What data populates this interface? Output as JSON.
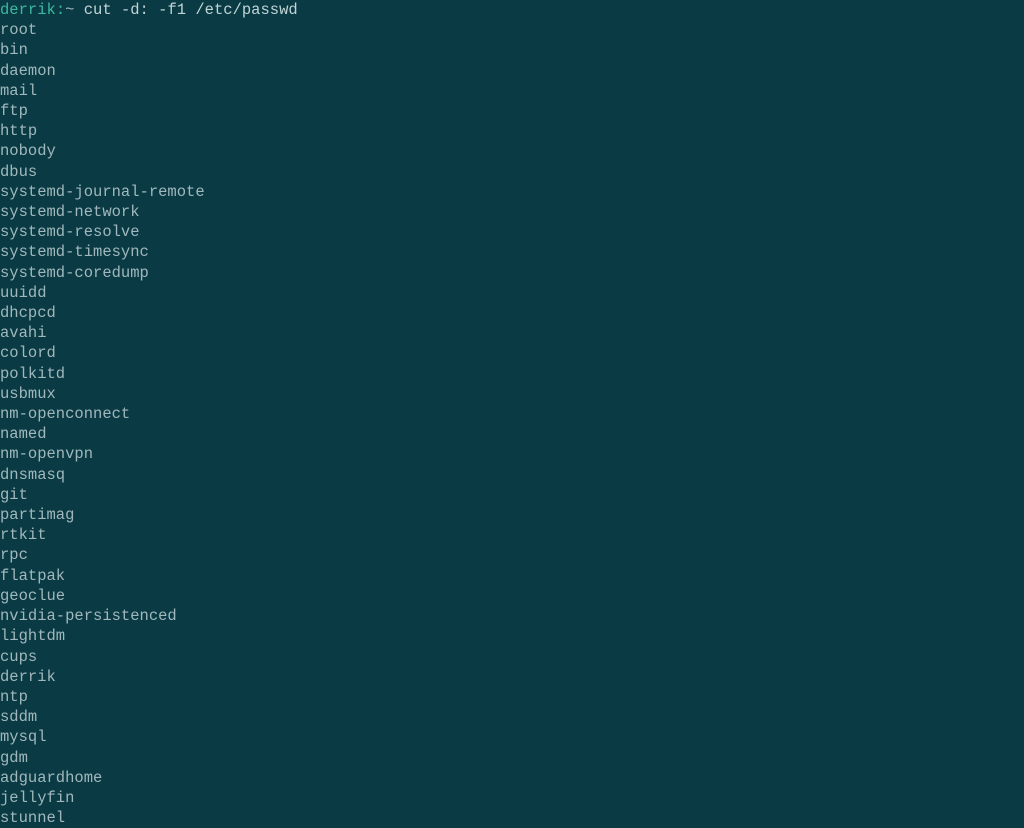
{
  "prompt": {
    "user": "derrik",
    "host_separator": ":",
    "path": "~",
    "command": " cut -d: -f1 /etc/passwd"
  },
  "output_lines": [
    "root",
    "bin",
    "daemon",
    "mail",
    "ftp",
    "http",
    "nobody",
    "dbus",
    "systemd-journal-remote",
    "systemd-network",
    "systemd-resolve",
    "systemd-timesync",
    "systemd-coredump",
    "uuidd",
    "dhcpcd",
    "avahi",
    "colord",
    "polkitd",
    "usbmux",
    "nm-openconnect",
    "named",
    "nm-openvpn",
    "dnsmasq",
    "git",
    "partimag",
    "rtkit",
    "rpc",
    "flatpak",
    "geoclue",
    "nvidia-persistenced",
    "lightdm",
    "cups",
    "derrik",
    "ntp",
    "sddm",
    "mysql",
    "gdm",
    "adguardhome",
    "jellyfin",
    "stunnel"
  ]
}
